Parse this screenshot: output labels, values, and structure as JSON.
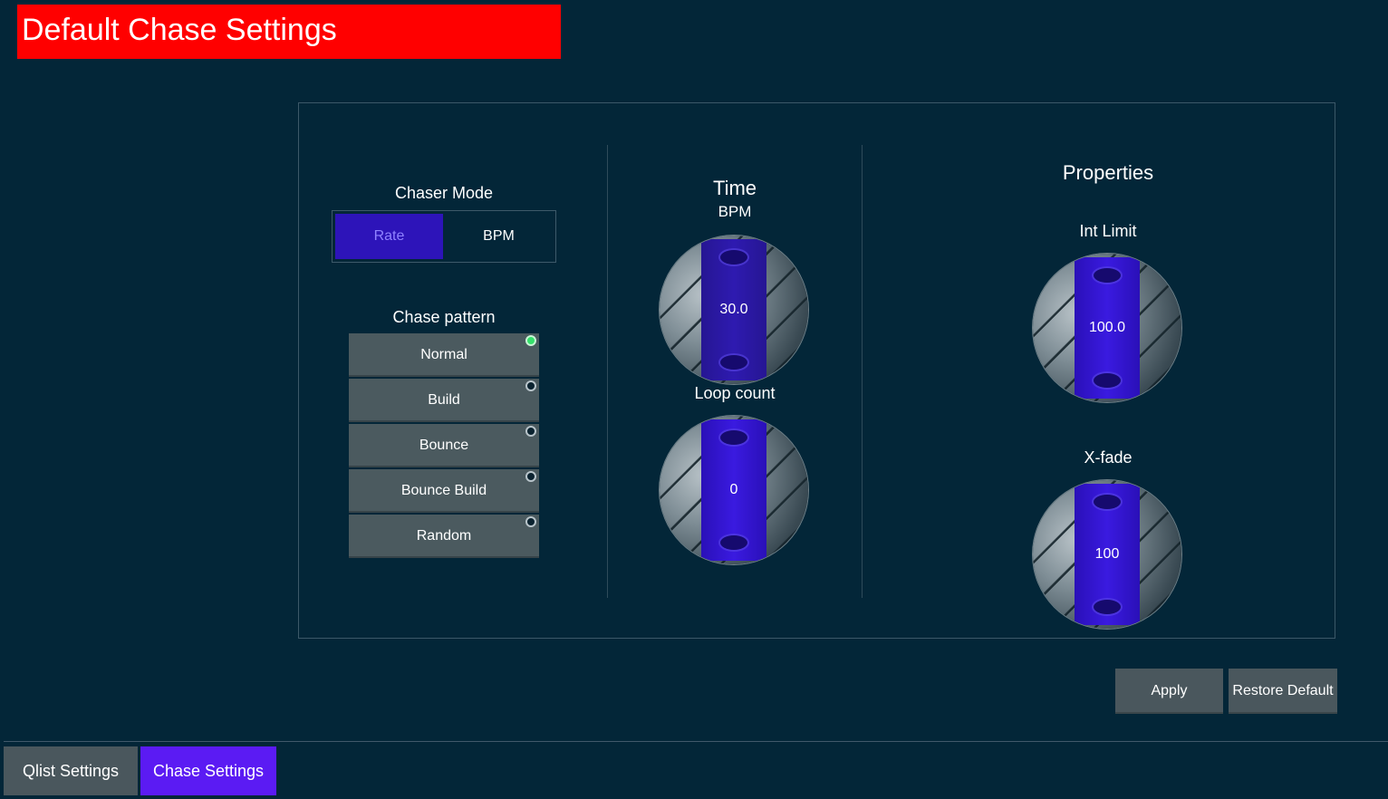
{
  "page_title": "Default Chase Settings",
  "chaser_mode": {
    "label": "Chaser Mode",
    "options": [
      "Rate",
      "BPM"
    ],
    "selected": "Rate"
  },
  "chase_pattern": {
    "label": "Chase pattern",
    "items": [
      {
        "label": "Normal",
        "selected": true
      },
      {
        "label": "Build",
        "selected": false
      },
      {
        "label": "Bounce",
        "selected": false
      },
      {
        "label": "Bounce Build",
        "selected": false
      },
      {
        "label": "Random",
        "selected": false
      }
    ]
  },
  "time": {
    "heading": "Time",
    "bpm_label": "BPM",
    "bpm_value": "30.0",
    "loop_label": "Loop count",
    "loop_value": "0"
  },
  "properties": {
    "heading": "Properties",
    "int_limit_label": "Int Limit",
    "int_limit_value": "100.0",
    "xfade_label": "X-fade",
    "xfade_value": "100"
  },
  "actions": {
    "apply": "Apply",
    "restore": "Restore Default"
  },
  "tabs": {
    "qlist": "Qlist Settings",
    "chase": "Chase Settings"
  },
  "colors": {
    "background": "#032638",
    "title_bar": "#ff0000",
    "active_tab": "#5b1bf3",
    "knob_band": "#3a1ae0",
    "selected_indicator": "#35e06b"
  }
}
